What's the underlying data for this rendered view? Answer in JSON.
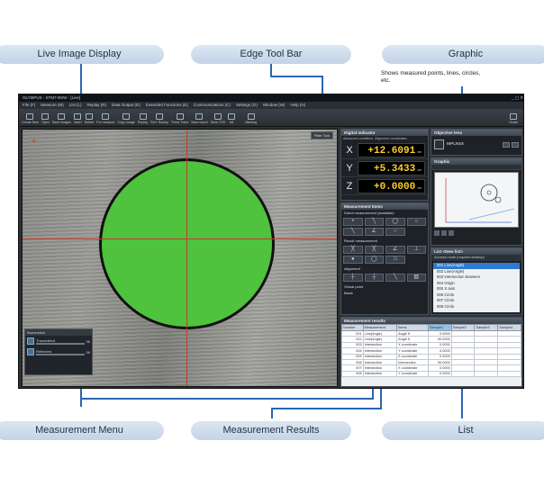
{
  "callouts": {
    "live_image_display": "Live Image Display",
    "edge_tool_bar": "Edge Tool Bar",
    "graphic": "Graphic",
    "graphic_note": "Shows measured points, lines, circles, etc.",
    "measurement_menu": "Measurement Menu",
    "measurement_results": "Measurement Results",
    "list": "List"
  },
  "app": {
    "title": "OLYMPUS - STM7-BSW - [Live]",
    "menus": [
      "File (F)",
      "Measure (M)",
      "List (L)",
      "Replay (R)",
      "Data Output (D)",
      "Extended Functions (E)",
      "Communications (C)",
      "Settings (O)",
      "Window (W)",
      "Help (H)"
    ],
    "toolbar": [
      "Create New",
      "Open",
      "Save Images",
      "Insert",
      "Delete",
      "For measure",
      "Copy Image",
      "Replay",
      "Perf. Replay",
      "Trend Trans",
      "Save report",
      "Save CSV",
      "M1",
      "Marking"
    ],
    "guide_label": "Guide",
    "live_filter_btn": "Filter Tool",
    "illumination": {
      "title": "Illumination",
      "transmitted": "Transmitted",
      "reflected": "Reflected",
      "transmitted_value": "56",
      "reflected_value": "56"
    },
    "digital_indicator": {
      "title": "Digital Indicator",
      "tabs": [
        "Advanced conditions",
        "Alignment coordinates"
      ],
      "rows": [
        {
          "axis": "X",
          "value": "+12.6091",
          "unit": "mm"
        },
        {
          "axis": "Y",
          "value": "+5.3433",
          "unit": "mm"
        },
        {
          "axis": "Z",
          "value": "+0.0000",
          "unit": "mm"
        }
      ]
    },
    "objective_lens": {
      "title": "Objective lens",
      "name": "MPLN5X"
    },
    "graphic_panel": {
      "title": "Graphic"
    },
    "measurement_items": {
      "title": "Measurement Items",
      "direct": "Direct measurement (available)",
      "result": "Result measurement",
      "alignment": "Alignment",
      "virtual": "Virtual point",
      "basis": "Basis",
      "direct_icons": [
        "•",
        "╲",
        "◯",
        "○",
        "╲",
        "∠",
        "○"
      ],
      "result_icons": [
        "╳",
        "╳",
        "∠",
        "⊥",
        "●",
        "◯",
        "□"
      ],
      "align_icons": [
        "┼",
        "┼",
        "╲",
        "▧"
      ]
    },
    "list_panel": {
      "title": "List <New list>",
      "header": "Accepts mode (requires desktop)",
      "items": [
        "001 Line(Angle)",
        "002 Line(Angle)",
        "003 Intersection between",
        "004 Origin",
        "005 X axis",
        "006 Circle",
        "007 Circle",
        "008 Circle"
      ]
    },
    "results": {
      "title": "Measurement results",
      "columns": [
        "Number",
        "Measurement",
        "Items",
        "Sample1",
        "Sample2",
        "Sample3",
        "Sample4"
      ],
      "rows": [
        [
          "001",
          "Line(Angle)",
          "Angle θ",
          "0.0000",
          "",
          "",
          ""
        ],
        [
          "002",
          "Line(Angle)",
          "Angle θ",
          "90.0000",
          "",
          "",
          ""
        ],
        [
          "003",
          "Intersection",
          "X coordinate",
          "0.0091",
          "",
          "",
          ""
        ],
        [
          "004",
          "Intersection",
          "Y coordinate",
          "0.0000",
          "",
          "",
          ""
        ],
        [
          "005",
          "Intersection",
          "Z coordinate",
          "0.0000",
          "",
          "",
          ""
        ],
        [
          "006",
          "Intersection",
          "Intersection",
          "90.0000",
          "",
          "",
          ""
        ],
        [
          "007",
          "Intersection",
          "X coordinate",
          "0.0000",
          "",
          "",
          ""
        ],
        [
          "008",
          "Intersection",
          "Y coordinate",
          "0.0000",
          "",
          "",
          ""
        ]
      ]
    }
  }
}
